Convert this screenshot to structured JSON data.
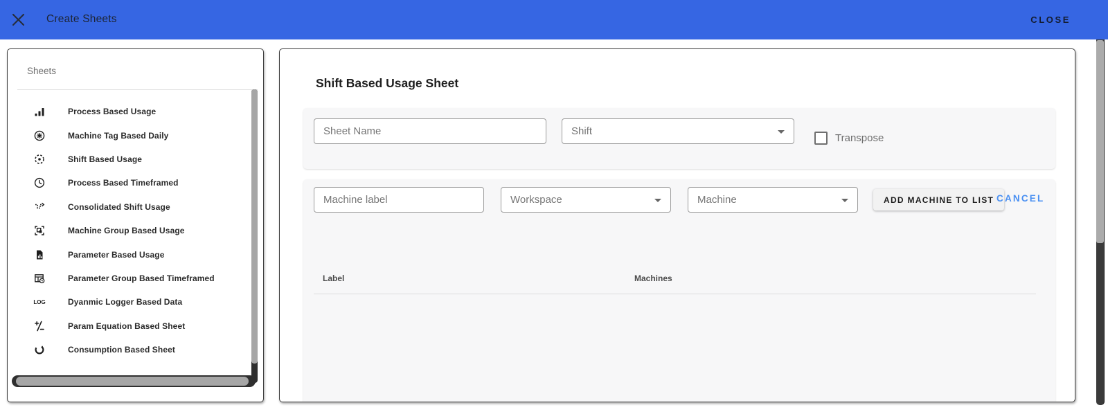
{
  "appbar": {
    "title": "Create Sheets",
    "close_label": "CLOSE"
  },
  "sidebar": {
    "title": "Sheets",
    "items": [
      {
        "label": "Process Based Usage",
        "icon": "bar-chart-icon"
      },
      {
        "label": "Machine Tag Based Daily",
        "icon": "gear-circle-icon"
      },
      {
        "label": "Shift Based Usage",
        "icon": "dashed-target-icon"
      },
      {
        "label": "Process Based Timeframed",
        "icon": "clock-icon"
      },
      {
        "label": "Consolidated Shift Usage",
        "icon": "dotted-route-icon"
      },
      {
        "label": "Machine Group Based Usage",
        "icon": "group-frame-icon"
      },
      {
        "label": "Parameter Based Usage",
        "icon": "document-chart-icon"
      },
      {
        "label": "Parameter Group Based Timeframed",
        "icon": "table-clock-icon"
      },
      {
        "label": "Dyanmic Logger Based Data",
        "icon": "log-icon"
      },
      {
        "label": "Param Equation Based Sheet",
        "icon": "plus-minus-icon"
      },
      {
        "label": "Consumption Based Sheet",
        "icon": "refresh-circle-icon"
      }
    ]
  },
  "main": {
    "heading": "Shift Based Usage Sheet",
    "sheet_form": {
      "sheet_name_placeholder": "Sheet Name",
      "sheet_name_value": "",
      "shift_placeholder": "Shift",
      "transpose_label": "Transpose",
      "transpose_checked": false
    },
    "machine_form": {
      "machine_label_placeholder": "Machine label",
      "machine_label_value": "",
      "workspace_placeholder": "Workspace",
      "machine_placeholder": "Machine",
      "add_button_label": "ADD MACHINE TO LIST",
      "cancel_label": "CANCEL"
    },
    "machine_table": {
      "columns": [
        "Label",
        "Machines"
      ],
      "rows": []
    }
  },
  "colors": {
    "appbar_blue": "#3666E3",
    "link_blue": "#4A90F2"
  }
}
